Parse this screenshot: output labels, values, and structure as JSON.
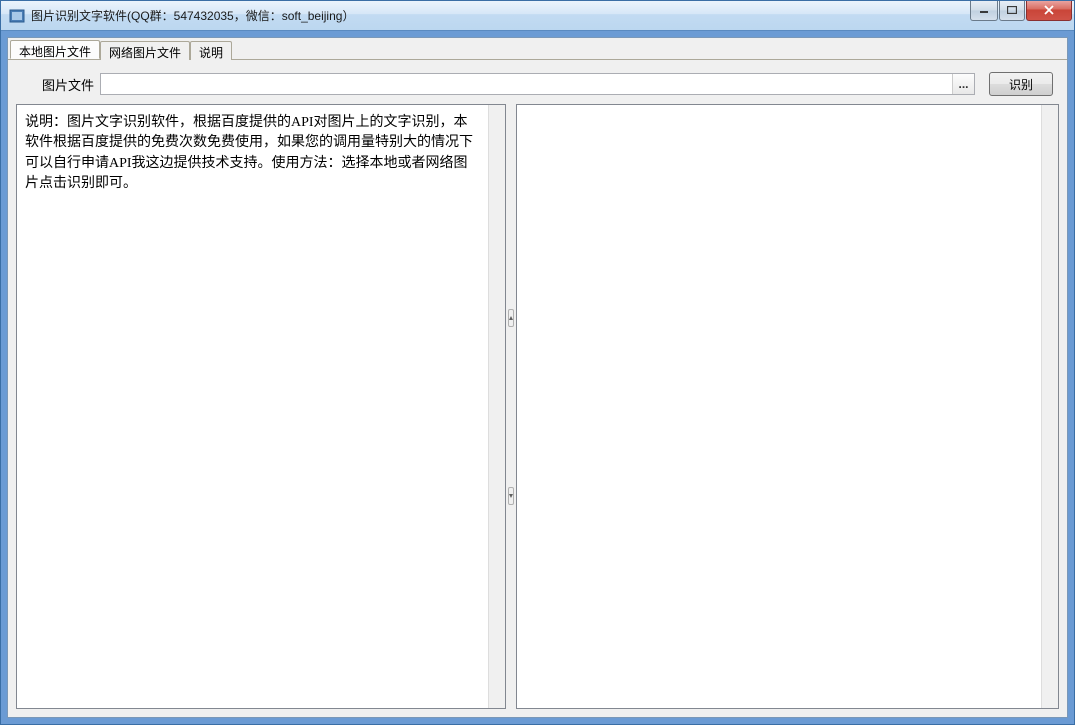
{
  "window": {
    "title": "图片识别文字软件(QQ群：547432035，微信：soft_beijing）"
  },
  "tabs": [
    {
      "label": "本地图片文件",
      "active": true
    },
    {
      "label": "网络图片文件",
      "active": false
    },
    {
      "label": "说明",
      "active": false
    }
  ],
  "toolbar": {
    "file_label": "图片文件",
    "file_value": "",
    "browse_label": "...",
    "recognize_label": "识别"
  },
  "left_pane": {
    "description": "说明：图片文字识别软件，根据百度提供的API对图片上的文字识别，本软件根据百度提供的免费次数免费使用，如果您的调用量特别大的情况下可以自行申请API我这边提供技术支持。使用方法：选择本地或者网络图片点击识别即可。"
  },
  "right_pane": {
    "content": ""
  }
}
